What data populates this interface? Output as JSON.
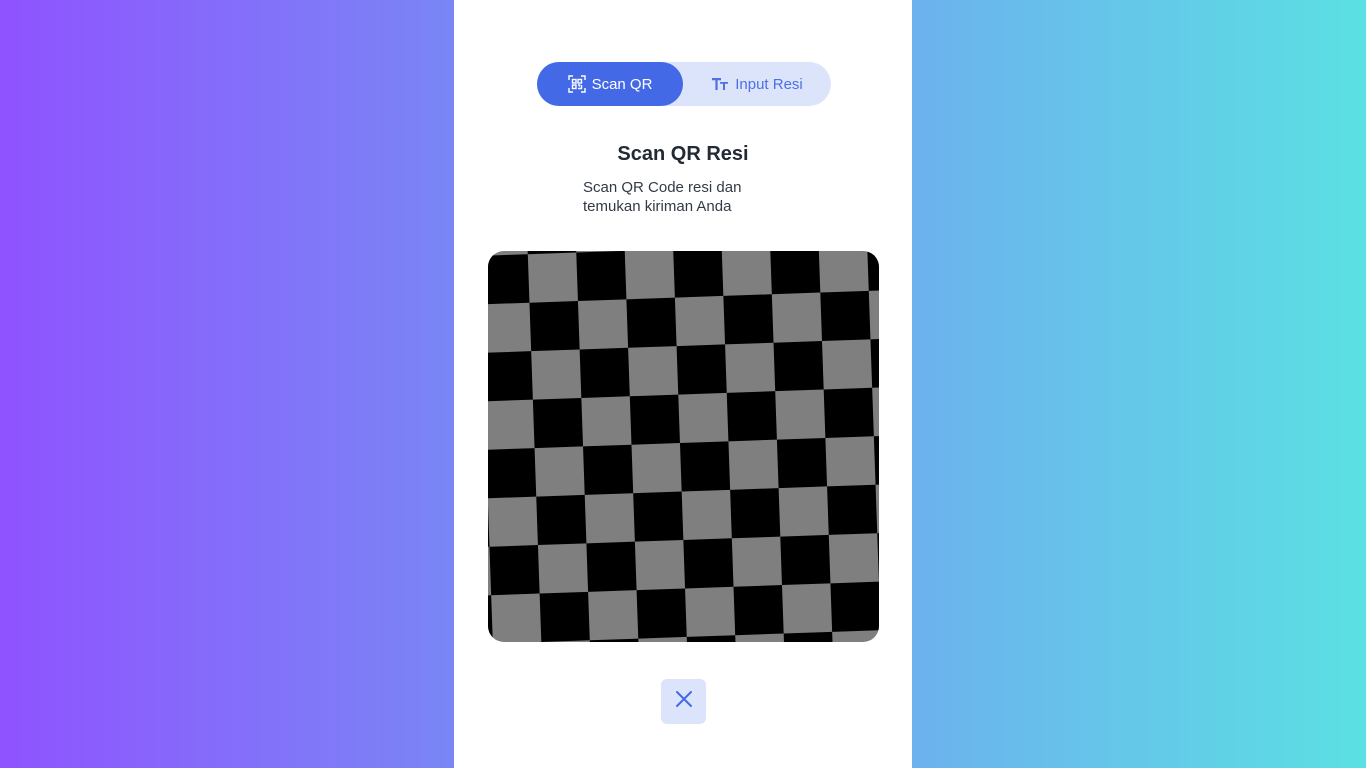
{
  "tabs": [
    {
      "label": "Scan QR",
      "icon": "qr-scan-icon",
      "active": true
    },
    {
      "label": "Input Resi",
      "icon": "text-type-icon",
      "active": false
    }
  ],
  "heading": {
    "title": "Scan QR Resi",
    "subtitle_line1": "Scan QR Code resi dan",
    "subtitle_line2": "temukan kiriman Anda"
  },
  "camera": {
    "icon": "camera-preview"
  },
  "close": {
    "icon": "close-icon"
  },
  "colors": {
    "accent": "#4469e6",
    "accent_light": "#dce4fb",
    "gradient_start": "#8f53ff",
    "gradient_end": "#5be0e3"
  }
}
